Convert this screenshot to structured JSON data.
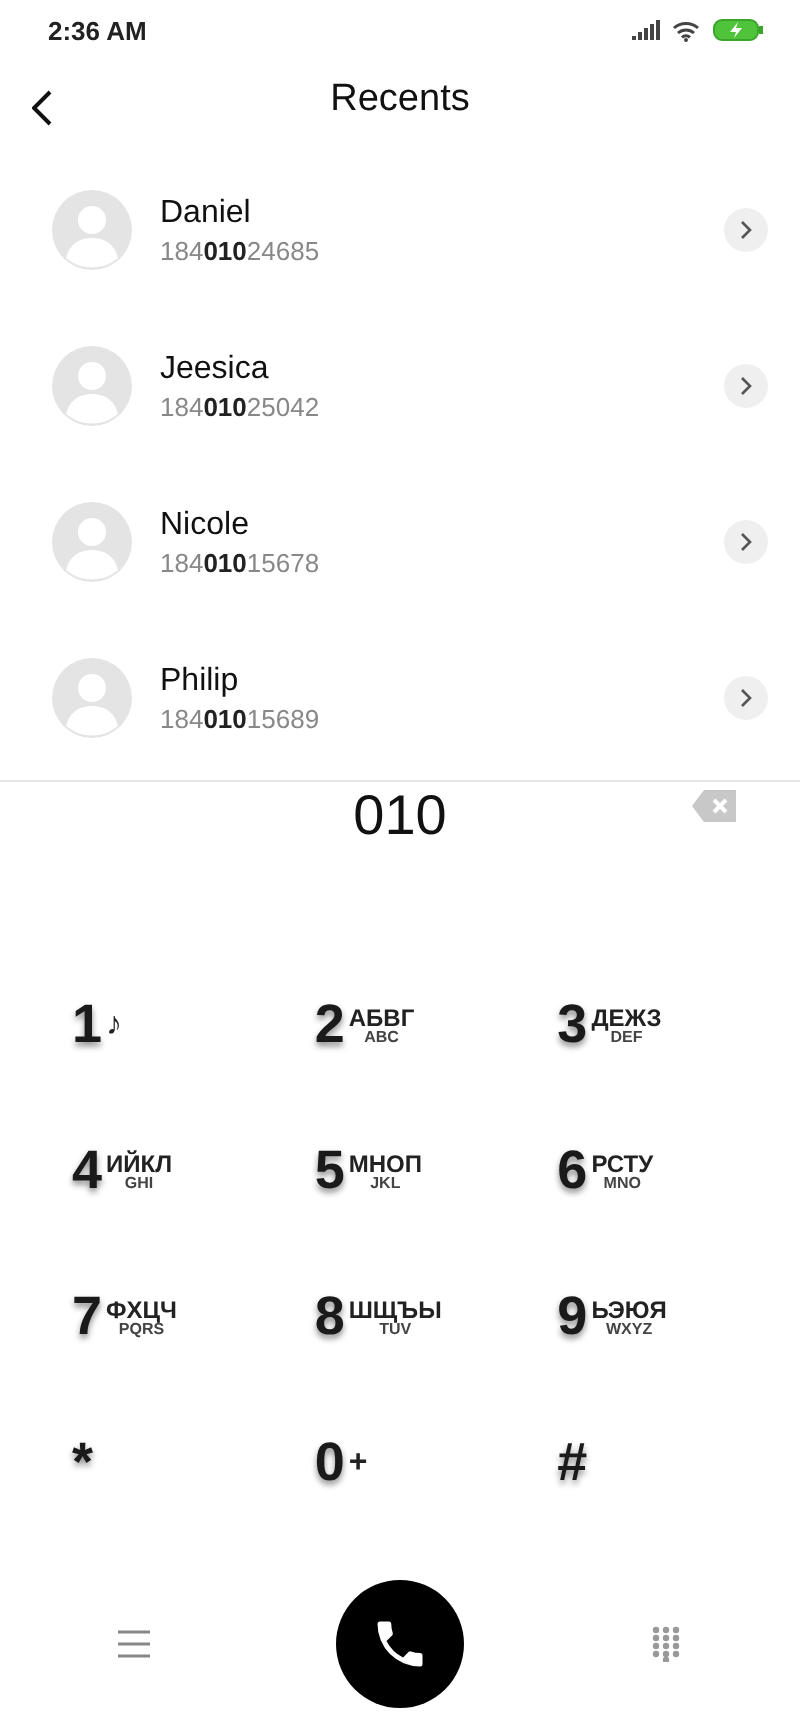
{
  "status_bar": {
    "time": "2:36 AM"
  },
  "header": {
    "title": "Recents"
  },
  "contacts": [
    {
      "name": "Daniel",
      "number": "184**010**24685"
    },
    {
      "name": "Jeesica",
      "number": "184**010**25042"
    },
    {
      "name": "Nicole",
      "number": "184**010**15678"
    },
    {
      "name": "Philip",
      "number": "184**010**15689"
    }
  ],
  "dialed": "010",
  "keys": [
    {
      "digit": "1",
      "top": "♪"
    },
    {
      "digit": "2",
      "top": "АБВГ",
      "bottom": "ABC"
    },
    {
      "digit": "3",
      "top": "ДЕЖЗ",
      "bottom": "DEF"
    },
    {
      "digit": "4",
      "top": "ИЙКЛ",
      "bottom": "GHI"
    },
    {
      "digit": "5",
      "top": "МНОП",
      "bottom": "JKL"
    },
    {
      "digit": "6",
      "top": "РСТУ",
      "bottom": "MNO"
    },
    {
      "digit": "7",
      "top": "ФХЦЧ",
      "bottom": "PQRS"
    },
    {
      "digit": "8",
      "top": "ШЩЪЫ",
      "bottom": "TUV"
    },
    {
      "digit": "9",
      "top": "ЬЭЮЯ",
      "bottom": "WXYZ"
    },
    {
      "digit": "*"
    },
    {
      "digit": "0",
      "top": "+"
    },
    {
      "digit": "#"
    }
  ]
}
